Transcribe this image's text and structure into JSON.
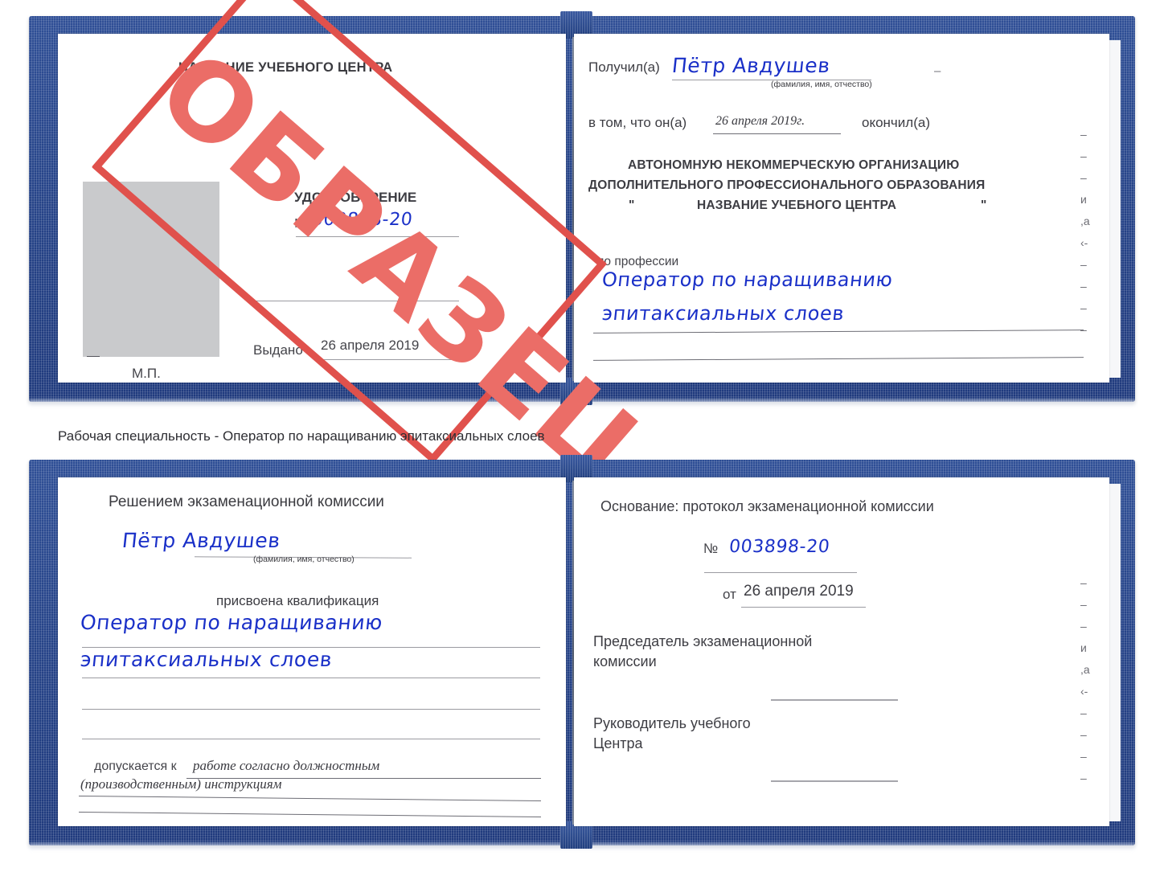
{
  "document": {
    "type": "certificate-scan",
    "caption": "Рабочая специальность - Оператор по наращиванию эпитаксиальных слоев",
    "watermark": "ОБРАЗЕЦ",
    "accent_blue": "#27458a",
    "ink_blue": "#1a30c8",
    "watermark_red": "#e0514c",
    "photo_placeholder_color": "#c9cacc"
  },
  "book_top": {
    "left_page": {
      "org_title": "НАЗВАНИЕ УЧЕБНОГО ЦЕНТРА",
      "doc_kind": "УДОСТОВЕРЕНИЕ",
      "number_label": "№",
      "number_value": "003898-20",
      "issued_label": "Выдано",
      "issued_value": "26 апреля 2019",
      "stamp_label": "М.П."
    },
    "right_page": {
      "received_label": "Получил(а)",
      "received_value": "Пётр Авдушев",
      "fio_hint": "(фамилия, имя, отчество)",
      "that_he_label": "в том, что он(а)",
      "that_he_value": "26 апреля 2019г.",
      "finished_label": "окончил(а)",
      "org_line1": "АВТОНОМНУЮ НЕКОММЕРЧЕСКУЮ ОРГАНИЗАЦИЮ",
      "org_line2": "ДОПОЛНИТЕЛЬНОГО ПРОФЕССИОНАЛЬНОГО ОБРАЗОВАНИЯ",
      "quote_open": "\"",
      "org_line3": "НАЗВАНИЕ УЧЕБНОГО ЦЕНТРА",
      "quote_close": "\"",
      "profession_label": "по профессии",
      "profession_line1": "Оператор по наращиванию",
      "profession_line2": "эпитаксиальных слоев",
      "crop_column": "–\n–\n–\nи\n,а\n‹-\n–\n–\n–\n–"
    }
  },
  "book_bottom": {
    "left_page": {
      "heading": "Решением экзаменационной комиссии",
      "name_value": "Пётр Авдушев",
      "fio_hint": "(фамилия, имя, отчество)",
      "qualification_label": "присвоена квалификация",
      "qualification_line1": "Оператор по наращиванию",
      "qualification_line2": "эпитаксиальных слоев",
      "admitted_label": "допускается к",
      "admitted_line1": "работе согласно должностным",
      "admitted_line2": "(производственным) инструкциям"
    },
    "right_page": {
      "basis_label": "Основание: протокол экзаменационной комиссии",
      "number_label": "№",
      "number_value": "003898-20",
      "date_label": "от",
      "date_value": "26 апреля 2019",
      "chair_line1": "Председатель экзаменационной",
      "chair_line2": "комиссии",
      "head_line1": "Руководитель учебного",
      "head_line2": "Центра",
      "crop_column": "–\n–\n–\nи\n,а\n‹-\n–\n–\n–\n–"
    }
  }
}
